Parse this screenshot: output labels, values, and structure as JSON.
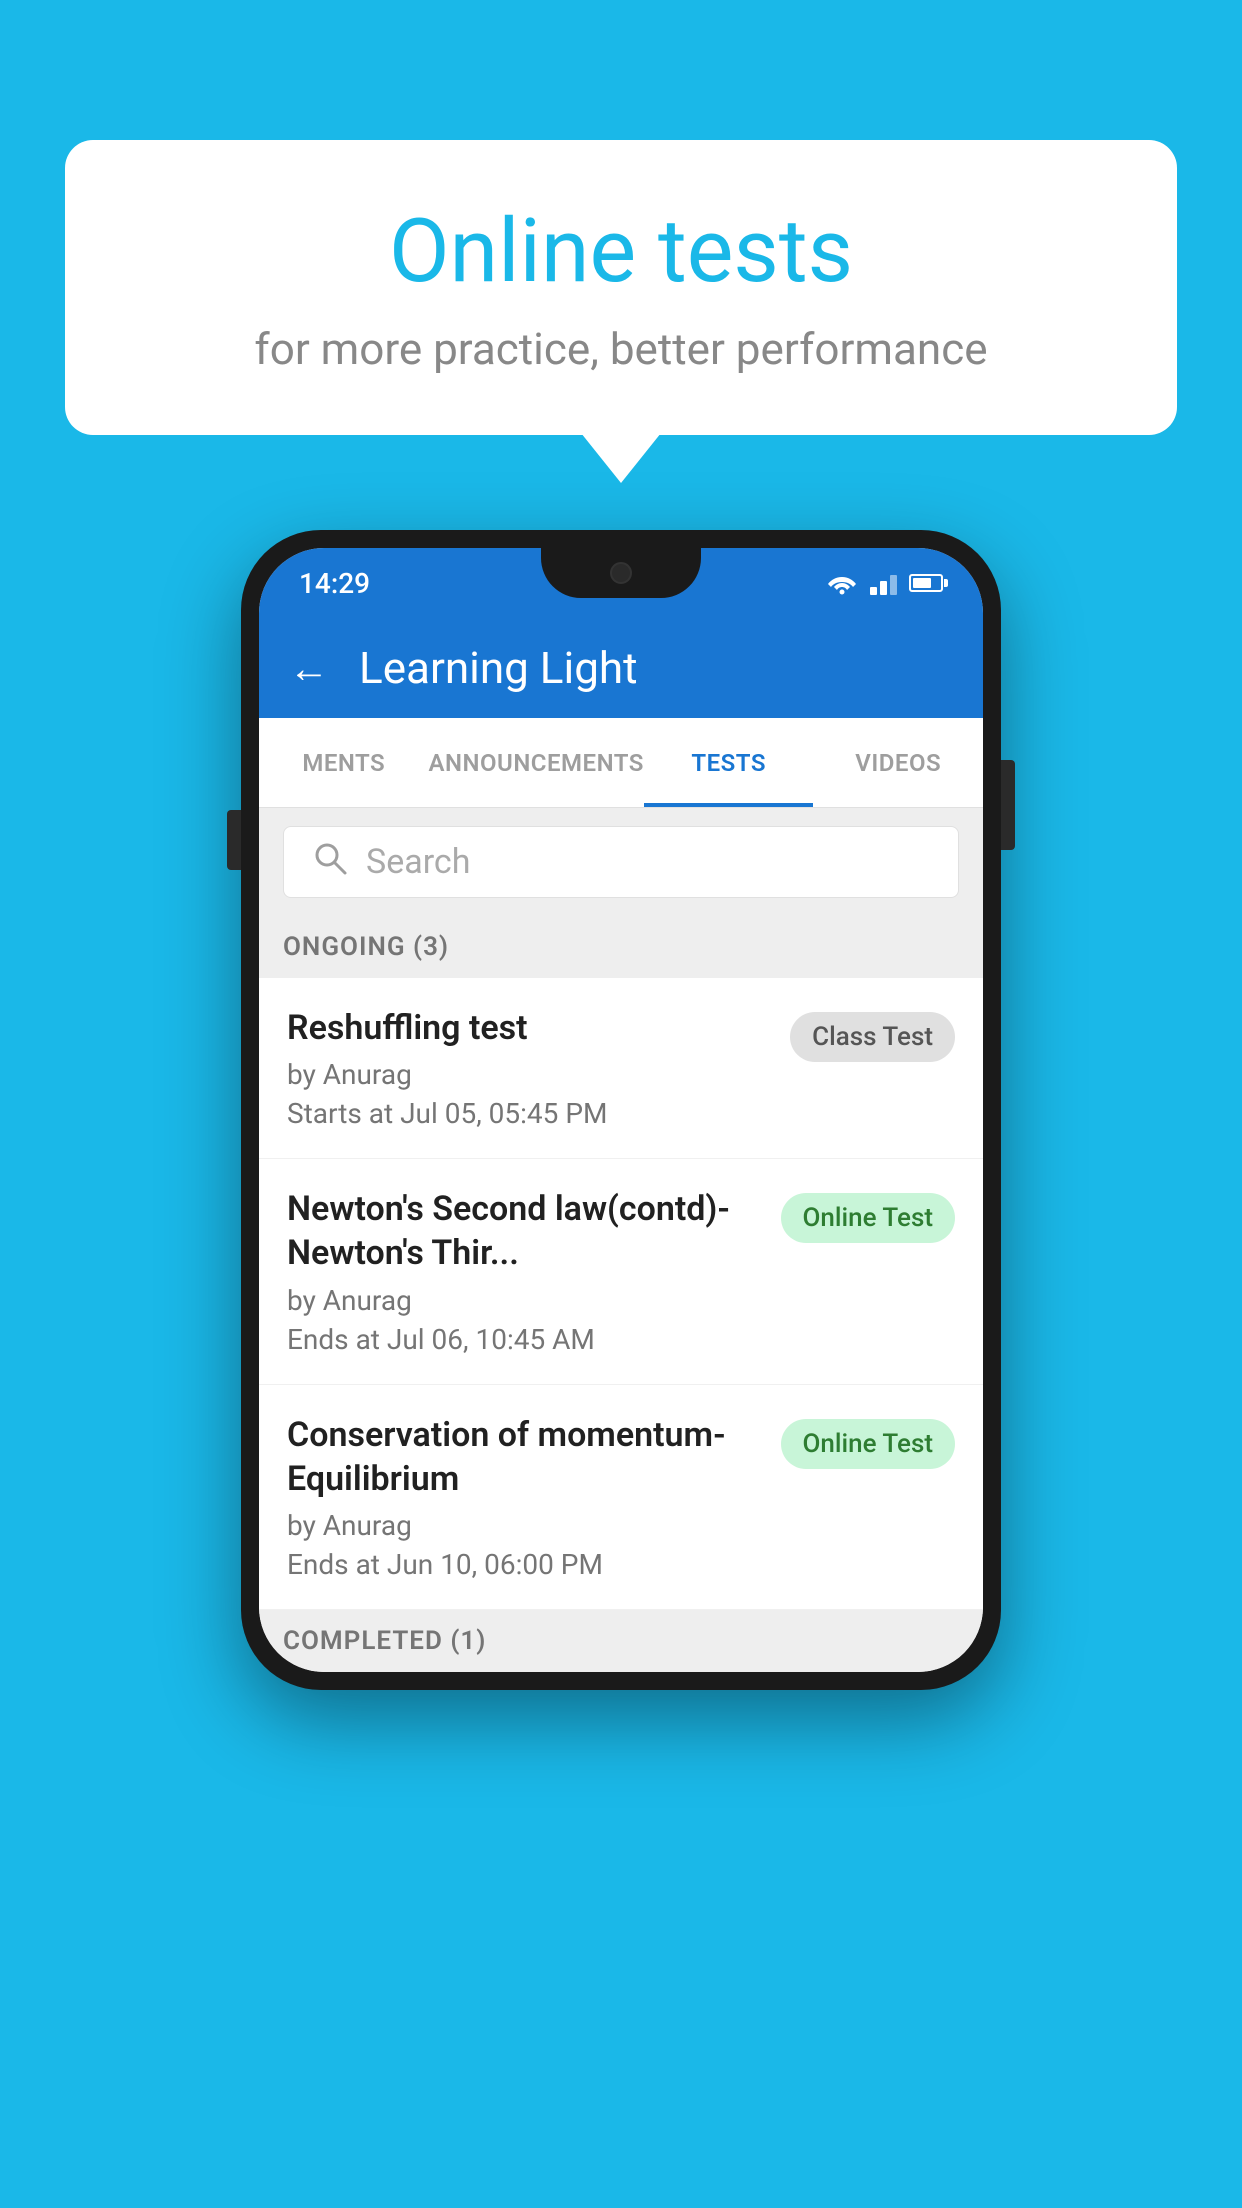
{
  "background_color": "#1ab8e8",
  "speech_bubble": {
    "title": "Online tests",
    "subtitle": "for more practice, better performance"
  },
  "phone": {
    "status_bar": {
      "time": "14:29"
    },
    "app_bar": {
      "title": "Learning Light",
      "back_label": "←"
    },
    "tabs": [
      {
        "label": "MENTS",
        "active": false
      },
      {
        "label": "ANNOUNCEMENTS",
        "active": false
      },
      {
        "label": "TESTS",
        "active": true
      },
      {
        "label": "VIDEOS",
        "active": false
      }
    ],
    "search": {
      "placeholder": "Search"
    },
    "sections": [
      {
        "label": "ONGOING (3)",
        "tests": [
          {
            "name": "Reshuffling test",
            "by": "by Anurag",
            "time": "Starts at  Jul 05, 05:45 PM",
            "badge": "Class Test",
            "badge_type": "class"
          },
          {
            "name": "Newton's Second law(contd)-Newton's Thir...",
            "by": "by Anurag",
            "time": "Ends at  Jul 06, 10:45 AM",
            "badge": "Online Test",
            "badge_type": "online"
          },
          {
            "name": "Conservation of momentum-Equilibrium",
            "by": "by Anurag",
            "time": "Ends at  Jun 10, 06:00 PM",
            "badge": "Online Test",
            "badge_type": "online"
          }
        ]
      }
    ],
    "completed_label": "COMPLETED (1)"
  }
}
